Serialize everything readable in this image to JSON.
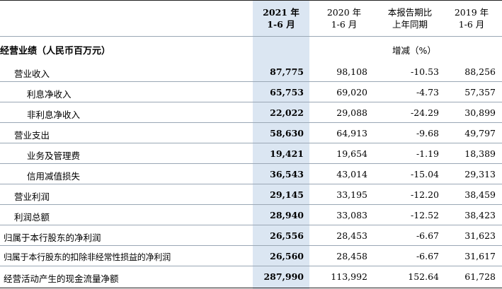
{
  "header": {
    "col1": {
      "line1": "2021 年",
      "line2": "1-6 月"
    },
    "col2": {
      "line1": "2020 年",
      "line2": "1-6 月"
    },
    "col3": {
      "line1": "本报告期比",
      "line2": "上年同期"
    },
    "col4": {
      "line1": "2019 年",
      "line2": "1-6 月"
    }
  },
  "section": {
    "label": "经营业绩（人民币百万元）",
    "unit": "增减（%）"
  },
  "rows": [
    {
      "name": "营业收入",
      "v2021": "87,775",
      "v2020": "98,108",
      "change": "-10.53",
      "v2019": "88,256"
    },
    {
      "name": "利息净收入",
      "v2021": "65,753",
      "v2020": "69,020",
      "change": "-4.73",
      "v2019": "57,357"
    },
    {
      "name": "非利息净收入",
      "v2021": "22,022",
      "v2020": "29,088",
      "change": "-24.29",
      "v2019": "30,899"
    },
    {
      "name": "营业支出",
      "v2021": "58,630",
      "v2020": "64,913",
      "change": "-9.68",
      "v2019": "49,797"
    },
    {
      "name": "业务及管理费",
      "v2021": "19,421",
      "v2020": "19,654",
      "change": "-1.19",
      "v2019": "18,389"
    },
    {
      "name": "信用减值损失",
      "v2021": "36,543",
      "v2020": "43,014",
      "change": "-15.04",
      "v2019": "29,313"
    },
    {
      "name": "营业利润",
      "v2021": "29,145",
      "v2020": "33,195",
      "change": "-12.20",
      "v2019": "38,459"
    },
    {
      "name": "利润总额",
      "v2021": "28,940",
      "v2020": "33,083",
      "change": "-12.52",
      "v2019": "38,423"
    },
    {
      "name": "归属于本行股东的净利润",
      "v2021": "26,556",
      "v2020": "28,453",
      "change": "-6.67",
      "v2019": "31,623"
    },
    {
      "name": "归属于本行股东的扣除非经常性损益的净利润",
      "v2021": "26,560",
      "v2020": "28,458",
      "change": "-6.67",
      "v2019": "31,617"
    },
    {
      "name": "经营活动产生的现金流量净额",
      "v2021": "287,990",
      "v2020": "113,992",
      "change": "152.64",
      "v2019": "61,728"
    }
  ]
}
